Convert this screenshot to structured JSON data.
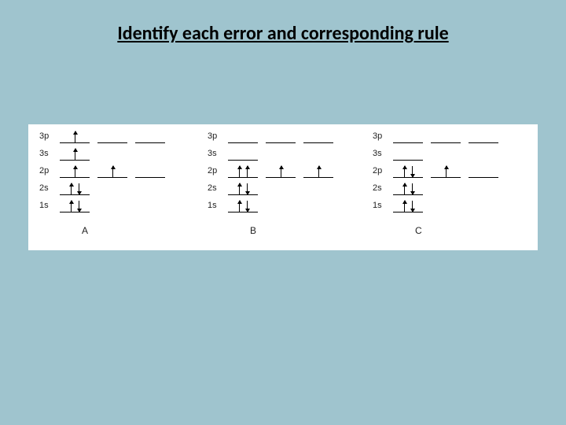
{
  "title": "Identify each error and corresponding rule",
  "orbitals": {
    "3p": "3p",
    "3s": "3s",
    "2p": "2p",
    "2s": "2s",
    "1s": "1s"
  },
  "panels": {
    "A": "A",
    "B": "B",
    "C": "C"
  },
  "chart_data": [
    {
      "type": "table",
      "title": "Electron configuration A",
      "label": "A",
      "levels": [
        {
          "orbital": "3p",
          "boxes": [
            [
              "up"
            ],
            [],
            []
          ]
        },
        {
          "orbital": "3s",
          "boxes": [
            [
              "up"
            ]
          ]
        },
        {
          "orbital": "2p",
          "boxes": [
            [
              "up"
            ],
            [
              "up"
            ],
            []
          ]
        },
        {
          "orbital": "2s",
          "boxes": [
            [
              "up",
              "down"
            ]
          ]
        },
        {
          "orbital": "1s",
          "boxes": [
            [
              "up",
              "down"
            ]
          ]
        }
      ]
    },
    {
      "type": "table",
      "title": "Electron configuration B",
      "label": "B",
      "levels": [
        {
          "orbital": "3p",
          "boxes": [
            [],
            [],
            []
          ]
        },
        {
          "orbital": "3s",
          "boxes": [
            []
          ]
        },
        {
          "orbital": "2p",
          "boxes": [
            [
              "up",
              "up"
            ],
            [
              "up"
            ],
            [
              "up"
            ]
          ]
        },
        {
          "orbital": "2s",
          "boxes": [
            [
              "up",
              "down"
            ]
          ]
        },
        {
          "orbital": "1s",
          "boxes": [
            [
              "up",
              "down"
            ]
          ]
        }
      ]
    },
    {
      "type": "table",
      "title": "Electron configuration C",
      "label": "C",
      "levels": [
        {
          "orbital": "3p",
          "boxes": [
            [],
            [],
            []
          ]
        },
        {
          "orbital": "3s",
          "boxes": [
            []
          ]
        },
        {
          "orbital": "2p",
          "boxes": [
            [
              "up",
              "down"
            ],
            [
              "up"
            ],
            []
          ]
        },
        {
          "orbital": "2s",
          "boxes": [
            [
              "up",
              "down"
            ]
          ]
        },
        {
          "orbital": "1s",
          "boxes": [
            [
              "up",
              "down"
            ]
          ]
        }
      ]
    }
  ]
}
